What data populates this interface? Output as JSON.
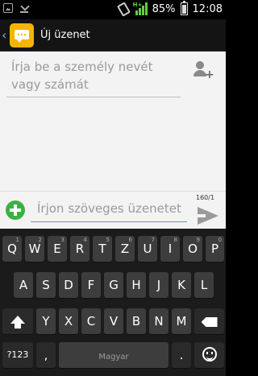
{
  "status_bar": {
    "battery": "85%",
    "time": "12:08",
    "network": "H+",
    "left_icons": [
      "image-icon",
      "download-icon"
    ]
  },
  "action_bar": {
    "title": "Új üzenet",
    "app_icon": "messaging-icon"
  },
  "recipient": {
    "placeholder": "Írja be a személy nevét vagy számát"
  },
  "compose": {
    "placeholder": "Írjon szöveges üzenetet",
    "counter": "160/1"
  },
  "keyboard": {
    "row1": [
      {
        "key": "Q",
        "hint": "1"
      },
      {
        "key": "W",
        "hint": "2"
      },
      {
        "key": "E",
        "hint": "3"
      },
      {
        "key": "R",
        "hint": "4"
      },
      {
        "key": "T",
        "hint": "5"
      },
      {
        "key": "Z",
        "hint": "6"
      },
      {
        "key": "U",
        "hint": "7"
      },
      {
        "key": "I",
        "hint": "8"
      },
      {
        "key": "O",
        "hint": "9"
      },
      {
        "key": "P",
        "hint": "0"
      }
    ],
    "row2": [
      "A",
      "S",
      "D",
      "F",
      "G",
      "H",
      "J",
      "K",
      "L"
    ],
    "row3": [
      "Y",
      "X",
      "C",
      "V",
      "B",
      "N",
      "M"
    ],
    "symbols_key": "?123",
    "comma_key": ",",
    "space_label": "Magyar",
    "period_key": ".",
    "accent_color": "#4aa3c7"
  }
}
